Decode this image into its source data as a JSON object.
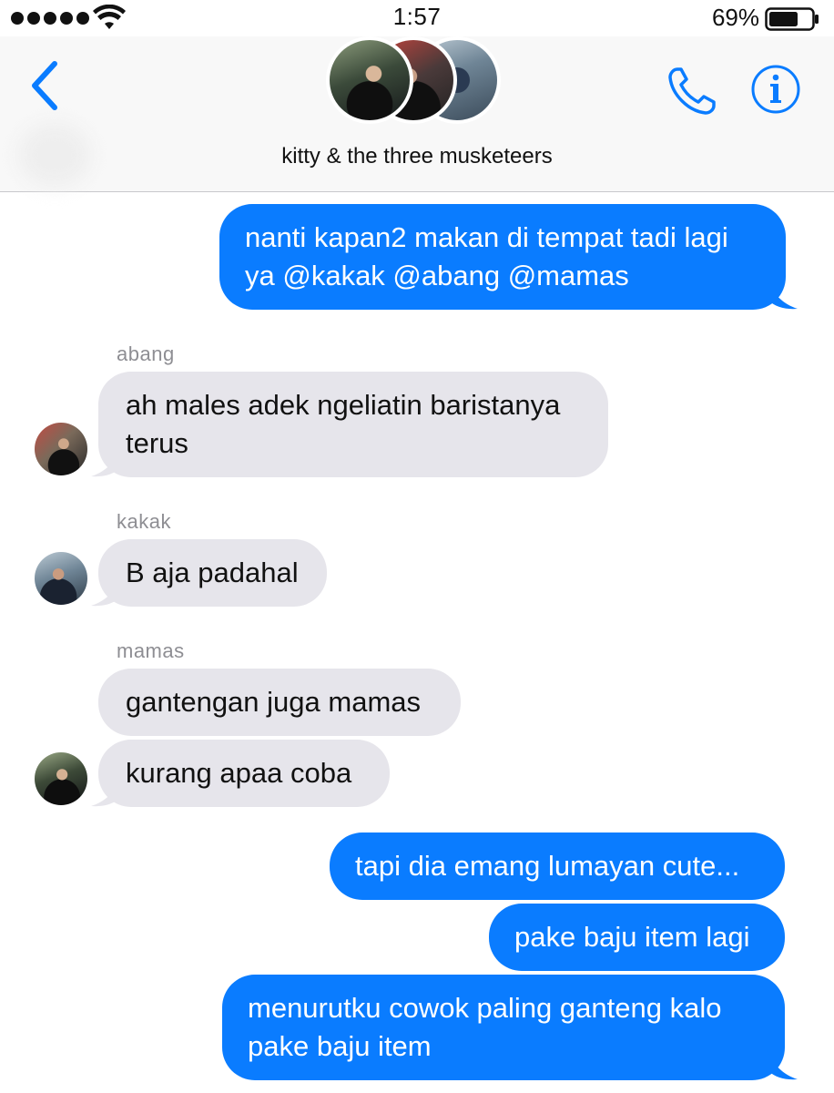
{
  "status_bar": {
    "time": "1:57",
    "battery_percent": "69%",
    "battery_level": 0.69,
    "signal_bars": 5,
    "wifi_icon": "wifi-icon"
  },
  "header": {
    "back_icon": "chevron-left-icon",
    "group_name": "kitty & the three musketeers",
    "phone_icon": "phone-icon",
    "info_icon": "info-icon",
    "accent_color": "#0a7cff"
  },
  "messages": [
    {
      "direction": "outgoing",
      "lines": [
        "nanti kapan2 makan di tempat tadi lagi",
        "ya @kakak @abang @mamas"
      ]
    },
    {
      "direction": "incoming",
      "sender": "abang",
      "lines": [
        "ah males adek ngeliatin baristanya",
        "terus"
      ]
    },
    {
      "direction": "incoming",
      "sender": "kakak",
      "lines": [
        "B aja padahal"
      ]
    },
    {
      "direction": "incoming",
      "sender": "mamas",
      "lines": [
        "gantengan juga mamas"
      ]
    },
    {
      "direction": "incoming",
      "sender": "mamas",
      "lines": [
        "kurang apaa coba"
      ]
    },
    {
      "direction": "outgoing",
      "lines": [
        "tapi dia emang lumayan cute..."
      ]
    },
    {
      "direction": "outgoing",
      "lines": [
        "pake baju item lagi"
      ]
    },
    {
      "direction": "outgoing",
      "lines": [
        "menurutku cowok paling ganteng kalo",
        "pake baju item"
      ]
    }
  ],
  "colors": {
    "outgoing_bubble": "#0a7cff",
    "incoming_bubble": "#e6e5eb",
    "sender_label": "#8e8e93"
  }
}
